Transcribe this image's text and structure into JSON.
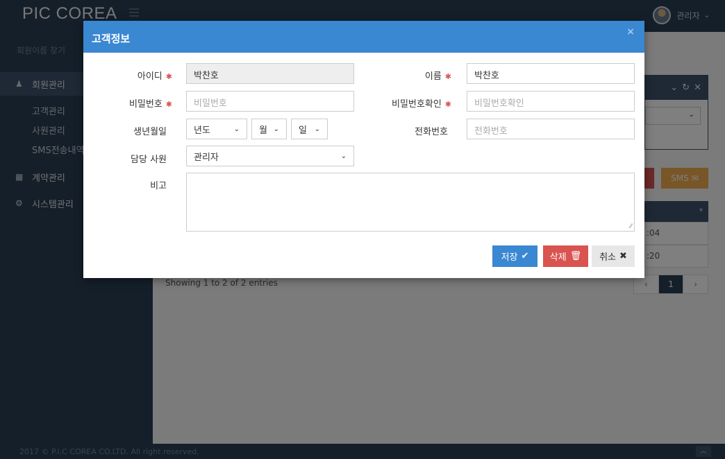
{
  "app": {
    "brand": "PIC COREA",
    "user_name": "관리자"
  },
  "sidebar": {
    "search_label": "회원이름 찾기",
    "items": [
      {
        "label": "회원관리",
        "icon": "user-icon",
        "subitems": [
          "고객관리",
          "사원관리",
          "SMS전송내역"
        ]
      },
      {
        "label": "계약관리",
        "icon": "calendar-icon"
      },
      {
        "label": "시스템관리",
        "icon": "cogs-icon"
      }
    ]
  },
  "background": {
    "sms_button": "SMS",
    "table_times": [
      ":04",
      ":20"
    ],
    "showing_text": "Showing 1 to 2 of 2 entries",
    "pager": {
      "prev": "‹",
      "current": "1",
      "next": "›"
    }
  },
  "modal": {
    "title": "고객정보",
    "fields": {
      "id": {
        "label": "아이디",
        "value": "박찬호"
      },
      "name": {
        "label": "이름",
        "value": "박찬호"
      },
      "password": {
        "label": "비밀번호",
        "placeholder": "비밀번호"
      },
      "password_confirm": {
        "label": "비밀번호확인",
        "placeholder": "비밀번호확인"
      },
      "birth": {
        "label": "생년월일",
        "year": "년도",
        "month": "월",
        "day": "일"
      },
      "phone": {
        "label": "전화번호",
        "placeholder": "전화번호"
      },
      "staff": {
        "label": "담당 사원",
        "value": "관리자"
      },
      "memo": {
        "label": "비고",
        "value": ""
      }
    },
    "buttons": {
      "save": "저장",
      "delete": "삭제",
      "cancel": "취소"
    }
  },
  "footer": {
    "text": "2017 © P.I.C COREA CO.LTD. All right reserved."
  }
}
